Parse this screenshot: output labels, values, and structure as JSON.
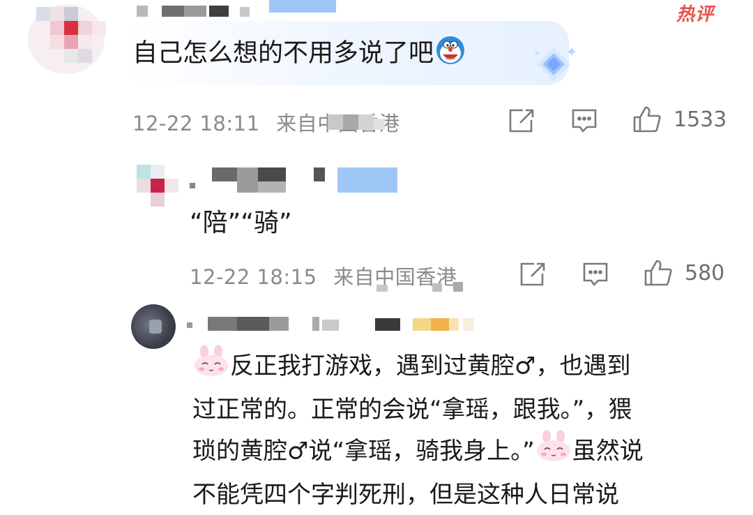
{
  "badge": {
    "hot_label": "热评"
  },
  "comments": [
    {
      "text": "自己怎么想的不用多说了吧",
      "timestamp": "12-22 18:11",
      "location": "来自中国香港",
      "likes": "1533"
    },
    {
      "text": "“陪”“骑”",
      "timestamp": "12-22 18:15",
      "location": "来自中国香港",
      "likes": "580"
    },
    {
      "text_lines": [
        "反正我打游戏，遇到过黄腔♂，也遇到",
        "过正常的。正常的会说“拿瑶，跟我。”，猥",
        "琐的黄腔♂说“拿瑶，骑我身上。”",
        "虽然说",
        "不能凭四个字判死刑，但是这种人日常说"
      ]
    }
  ],
  "icons": {
    "share": "share-icon",
    "comment": "comment-icon",
    "like": "thumbs-up-icon",
    "emoji_doraemon": "doraemon-emoji-icon",
    "emoji_bunny": "bunny-emoji-icon",
    "badge_diamond": "diamond-badge-icon"
  },
  "colors": {
    "meta_gray": "#8a8a8a",
    "hot_red": "#e4534a",
    "bubble_blue": "#e6f0ff"
  }
}
